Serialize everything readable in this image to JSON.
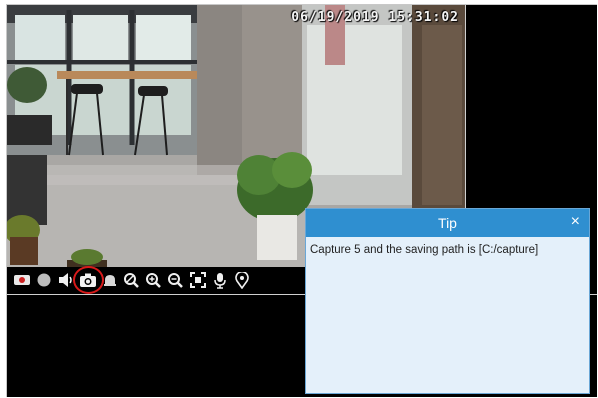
{
  "video": {
    "timestamp": "06/19/2019  15:31:02"
  },
  "toolbar": {
    "buttons": [
      {
        "name": "record-icon"
      },
      {
        "name": "stop-icon"
      },
      {
        "name": "volume-icon"
      },
      {
        "name": "snapshot-icon",
        "highlighted": true
      },
      {
        "name": "bell-icon"
      },
      {
        "name": "zoom-icon"
      },
      {
        "name": "zoom-in-icon"
      },
      {
        "name": "zoom-out-icon"
      },
      {
        "name": "fullscreen-icon"
      },
      {
        "name": "microphone-icon"
      },
      {
        "name": "location-pin-icon"
      }
    ],
    "highlight_color": "#d81a1a"
  },
  "tip": {
    "title": "Tip",
    "close_label": "×",
    "message": "Capture 5 and the saving path is [C:/capture]",
    "header_color": "#2f8fd0",
    "body_color": "#e4f0fa"
  }
}
